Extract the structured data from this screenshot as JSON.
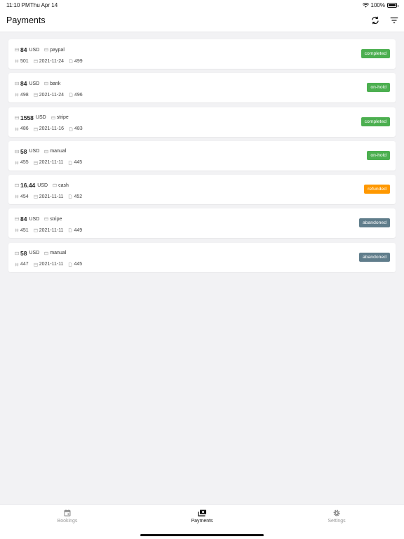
{
  "status_bar": {
    "time": "11:10 PM",
    "date": "Thu Apr 14",
    "battery": "100%"
  },
  "header": {
    "title": "Payments",
    "icons": [
      "refresh-icon",
      "filter-icon"
    ]
  },
  "payments": [
    {
      "amount": "84",
      "currency": "USD",
      "method": "paypal",
      "id": "501",
      "date": "2021-11-24",
      "booking": "499",
      "status": "completed",
      "status_color": "#4caf50"
    },
    {
      "amount": "84",
      "currency": "USD",
      "method": "bank",
      "id": "498",
      "date": "2021-11-24",
      "booking": "496",
      "status": "on-hold",
      "status_color": "#4caf50"
    },
    {
      "amount": "1558",
      "currency": "USD",
      "method": "stripe",
      "id": "486",
      "date": "2021-11-16",
      "booking": "483",
      "status": "completed",
      "status_color": "#4caf50"
    },
    {
      "amount": "58",
      "currency": "USD",
      "method": "manual",
      "id": "455",
      "date": "2021-11-11",
      "booking": "445",
      "status": "on-hold",
      "status_color": "#4caf50"
    },
    {
      "amount": "16.44",
      "currency": "USD",
      "method": "cash",
      "id": "454",
      "date": "2021-11-11",
      "booking": "452",
      "status": "refunded",
      "status_color": "#ff9800"
    },
    {
      "amount": "84",
      "currency": "USD",
      "method": "stripe",
      "id": "451",
      "date": "2021-11-11",
      "booking": "449",
      "status": "abandoned",
      "status_color": "#607d8b"
    },
    {
      "amount": "58",
      "currency": "USD",
      "method": "manual",
      "id": "447",
      "date": "2021-11-11",
      "booking": "445",
      "status": "abandoned",
      "status_color": "#607d8b"
    }
  ],
  "tabs": [
    {
      "label": "Bookings",
      "icon": "calendar-icon",
      "active": false
    },
    {
      "label": "Payments",
      "icon": "payments-icon",
      "active": true
    },
    {
      "label": "Settings",
      "icon": "gear-icon",
      "active": false
    }
  ]
}
